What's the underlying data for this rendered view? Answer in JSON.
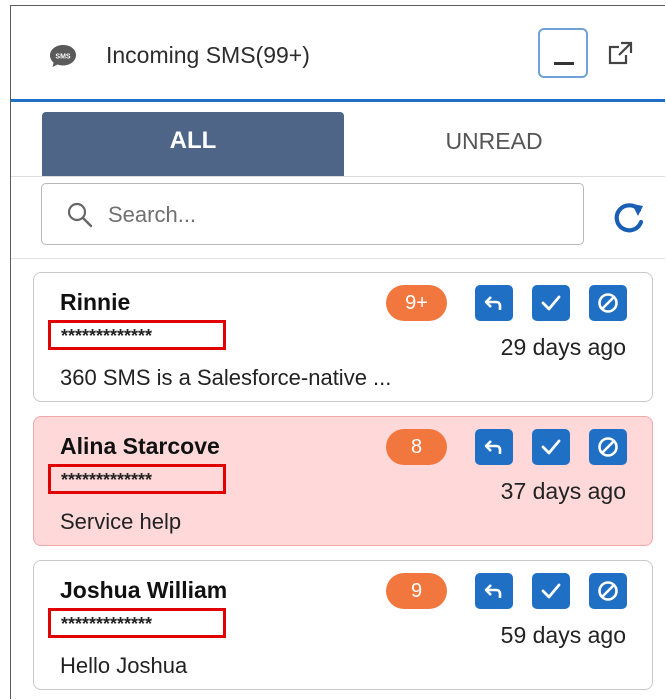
{
  "header": {
    "title": "Incoming SMS(99+)",
    "icon": "sms-chat-icon"
  },
  "tabs": [
    {
      "label": "ALL",
      "active": true
    },
    {
      "label": "UNREAD",
      "active": false
    }
  ],
  "search": {
    "placeholder": "Search...",
    "value": ""
  },
  "messages": [
    {
      "name": "Rinnie",
      "phone": "*************",
      "badge": "9+",
      "time": "29 days ago",
      "preview": "360 SMS is a Salesforce-native ...",
      "unread": false
    },
    {
      "name": "Alina Starcove",
      "phone": "*************",
      "badge": "8",
      "time": "37 days ago",
      "preview": "Service help",
      "unread": true
    },
    {
      "name": "Joshua William",
      "phone": "*************",
      "badge": "9",
      "time": "59 days ago",
      "preview": "Hello Joshua",
      "unread": false
    }
  ],
  "colors": {
    "accent": "#1f6fc5",
    "active_tab": "#4e6587",
    "badge": "#f2773e",
    "unread_bg": "#ffd9d9",
    "redaction": "#e00000"
  }
}
